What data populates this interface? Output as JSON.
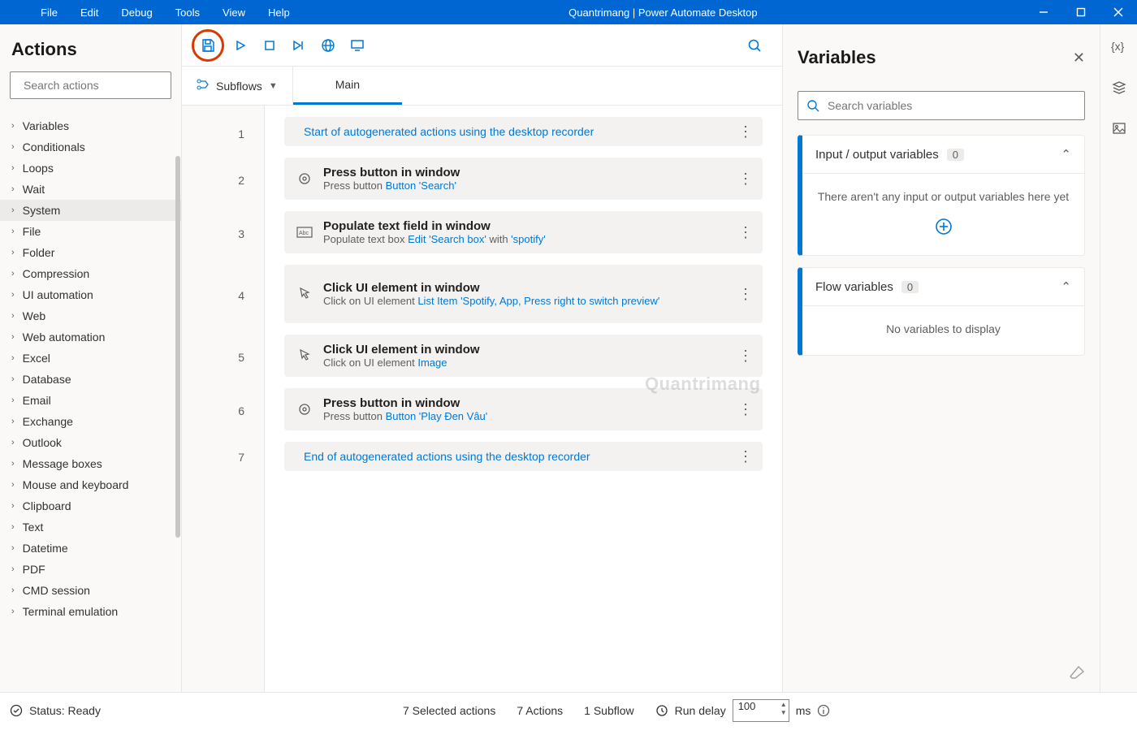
{
  "titlebar": {
    "menus": [
      "File",
      "Edit",
      "Debug",
      "Tools",
      "View",
      "Help"
    ],
    "title": "Quantrimang | Power Automate Desktop"
  },
  "left": {
    "title": "Actions",
    "search_placeholder": "Search actions",
    "categories": [
      "Variables",
      "Conditionals",
      "Loops",
      "Wait",
      "System",
      "File",
      "Folder",
      "Compression",
      "UI automation",
      "Web",
      "Web automation",
      "Excel",
      "Database",
      "Email",
      "Exchange",
      "Outlook",
      "Message boxes",
      "Mouse and keyboard",
      "Clipboard",
      "Text",
      "Datetime",
      "PDF",
      "CMD session",
      "Terminal emulation"
    ],
    "selected": "System"
  },
  "center": {
    "subflows_label": "Subflows",
    "tab_main": "Main",
    "steps": [
      {
        "line": "1",
        "kind": "marker",
        "text": "Start of autogenerated actions using the desktop recorder"
      },
      {
        "line": "2",
        "kind": "action",
        "icon": "press",
        "title": "Press button in window",
        "sub_pre": "Press button ",
        "sub_link": "Button 'Search'",
        "sub_post": ""
      },
      {
        "line": "3",
        "kind": "action",
        "icon": "text",
        "title": "Populate text field in window",
        "sub_pre": "Populate text box ",
        "sub_link": "Edit 'Search box'",
        "sub_mid": " with ",
        "sub_link2": "'spotify'"
      },
      {
        "line": "4",
        "kind": "action",
        "icon": "click",
        "title": "Click UI element in window",
        "sub_pre": "Click on UI element ",
        "sub_link": "List Item 'Spotify, App, Press right to switch preview'",
        "sub_post": ""
      },
      {
        "line": "5",
        "kind": "action",
        "icon": "click",
        "title": "Click UI element in window",
        "sub_pre": "Click on UI element ",
        "sub_link": "Image",
        "sub_post": ""
      },
      {
        "line": "6",
        "kind": "action",
        "icon": "press",
        "title": "Press button in window",
        "sub_pre": "Press button ",
        "sub_link": "Button 'Play Đen Vâu'",
        "sub_post": ""
      },
      {
        "line": "7",
        "kind": "marker",
        "text": "End of autogenerated actions using the desktop recorder"
      }
    ]
  },
  "right": {
    "title": "Variables",
    "search_placeholder": "Search variables",
    "io_vars_label": "Input / output variables",
    "io_vars_count": "0",
    "io_vars_empty": "There aren't any input or output variables here yet",
    "flow_vars_label": "Flow variables",
    "flow_vars_count": "0",
    "flow_vars_empty": "No variables to display"
  },
  "status": {
    "ready": "Status: Ready",
    "selected": "7 Selected actions",
    "actions": "7 Actions",
    "subflow": "1 Subflow",
    "delay_label": "Run delay",
    "delay_value": "100",
    "delay_unit": "ms"
  },
  "watermark": "Quantrimang"
}
